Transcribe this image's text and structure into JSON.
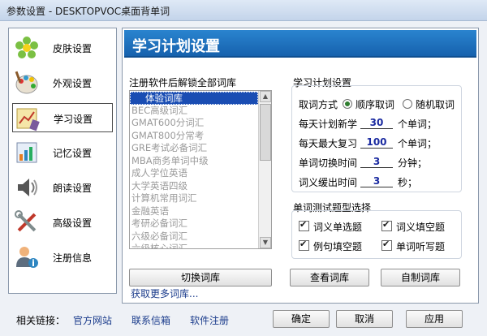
{
  "window": {
    "title": "参数设置 - DESKTOPVOC桌面背单词"
  },
  "sidebar": {
    "items": [
      {
        "label": "皮肤设置",
        "icon": "flower-icon"
      },
      {
        "label": "外观设置",
        "icon": "palette-icon"
      },
      {
        "label": "学习设置",
        "icon": "study-chart-icon",
        "active": true
      },
      {
        "label": "记忆设置",
        "icon": "bar-chart-icon"
      },
      {
        "label": "朗读设置",
        "icon": "speaker-icon"
      },
      {
        "label": "高级设置",
        "icon": "tools-icon"
      },
      {
        "label": "注册信息",
        "icon": "user-info-icon"
      }
    ]
  },
  "main": {
    "header_title": "学习计划设置",
    "library": {
      "label": "注册软件后解锁全部词库",
      "items": [
        "体验词库",
        "BEC高级词汇",
        "GMAT600分词汇",
        "GMAT800分常考",
        "GRE考试必备词汇",
        "MBA商务单词中级",
        "成人学位英语",
        "大学英语四级",
        "计算机常用词汇",
        "金融英语",
        "考研必备词汇",
        "六级必备词汇",
        "六级核心词汇"
      ],
      "selected_index": 0,
      "switch_button": "切换词库",
      "more_link": "获取更多词库..."
    },
    "plan": {
      "title": "学习计划设置",
      "mode_label": "取词方式",
      "mode_options": [
        "顺序取词",
        "随机取词"
      ],
      "mode_selected": 0,
      "daily_new_prefix": "每天计划新学",
      "daily_new_value": "30",
      "daily_new_suffix": "个单词；",
      "daily_review_prefix": "每天最大复习",
      "daily_review_value": "100",
      "daily_review_suffix": "个单词；",
      "switch_time_prefix": "单词切换时间",
      "switch_time_value": "3",
      "switch_time_suffix": "分钟；",
      "delay_prefix": "词义缓出时间",
      "delay_value": "3",
      "delay_suffix": "秒；"
    },
    "test": {
      "title": "单词测试题型选择",
      "options": [
        {
          "label": "词义单选题",
          "checked": true
        },
        {
          "label": "词义填空题",
          "checked": true
        },
        {
          "label": "例句填空题",
          "checked": true
        },
        {
          "label": "单词听写题",
          "checked": true
        }
      ]
    },
    "view_library_button": "查看词库",
    "custom_library_button": "自制词库"
  },
  "footer": {
    "related_label": "相关链接：",
    "links": [
      "官方网站",
      "联系信箱",
      "软件注册"
    ],
    "ok_button": "确定",
    "cancel_button": "取消",
    "apply_button": "应用"
  }
}
